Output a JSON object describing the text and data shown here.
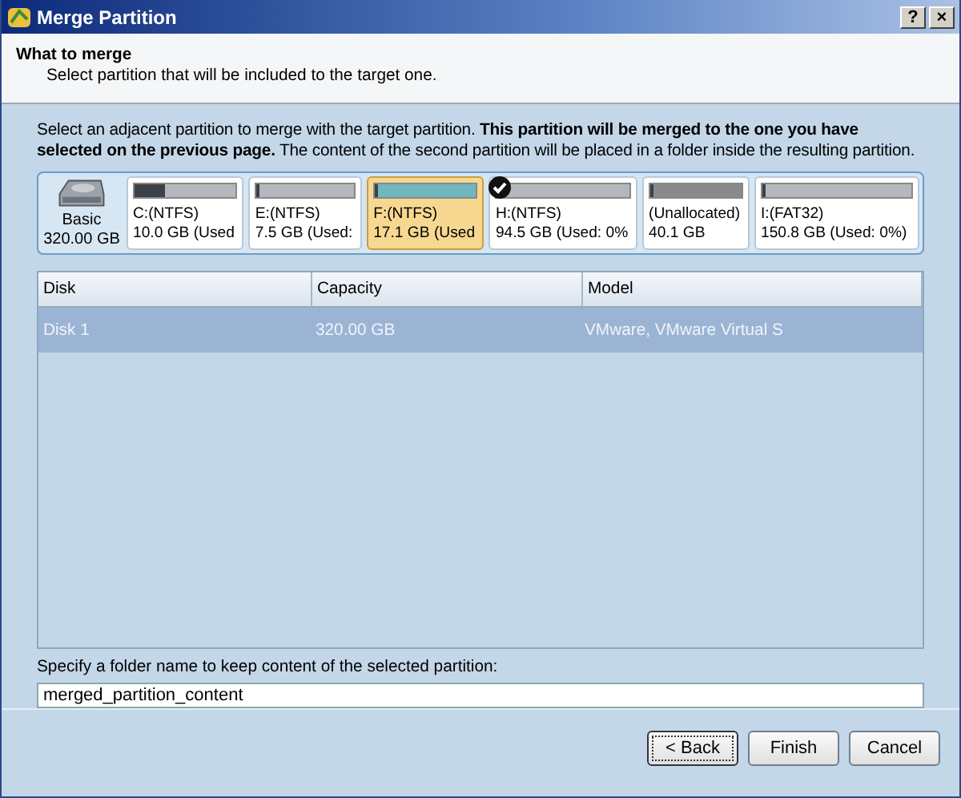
{
  "window": {
    "title": "Merge Partition",
    "buttons": [
      "?",
      "×"
    ]
  },
  "header": {
    "title": "What to merge",
    "subtitle": "Select partition that will be included to the target one."
  },
  "description": "Select an adjacent partition to merge with the target partition. **This partition will be merged to the one you have selected on the previous page.** The content of the second partition will be placed in a folder inside the resulting partition.",
  "disk": {
    "type": "Basic",
    "size": "320.00 GB"
  },
  "partitions": [
    {
      "name": "C:(NTFS)",
      "size": "10.0 GB (Used",
      "level": 0.3,
      "kind": "partition",
      "selected": false,
      "target": false
    },
    {
      "name": "E:(NTFS)",
      "size": "7.5 GB (Used:",
      "level": 0,
      "kind": "partition",
      "selected": false,
      "target": false
    },
    {
      "name": "F:(NTFS)",
      "size": "17.1 GB (Used",
      "level": 0,
      "kind": "partition",
      "selected": true,
      "target": false
    },
    {
      "name": "H:(NTFS)",
      "size": "94.5 GB (Used: 0%",
      "level": 0,
      "kind": "partition",
      "selected": false,
      "target": true
    },
    {
      "name": "(Unallocated)",
      "size": "40.1 GB",
      "level": 0,
      "kind": "unallocated",
      "selected": false,
      "target": false
    },
    {
      "name": "I:(FAT32)",
      "size": "150.8 GB (Used: 0%)",
      "level": 0,
      "kind": "partition",
      "selected": false,
      "target": false
    }
  ],
  "table": {
    "columns": [
      "Disk",
      "Capacity",
      "Model"
    ],
    "rows": [
      {
        "cells": [
          "Disk 1",
          "320.00 GB",
          "VMware, VMware Virtual S"
        ],
        "selected": true
      }
    ]
  },
  "folder": {
    "label": "Specify a folder name to keep content of the selected partition:",
    "value": "merged_partition_content"
  },
  "buttons": [
    {
      "label": "< Back",
      "default": true
    },
    {
      "label": "Finish",
      "default": false
    },
    {
      "label": "Cancel",
      "default": false
    }
  ]
}
